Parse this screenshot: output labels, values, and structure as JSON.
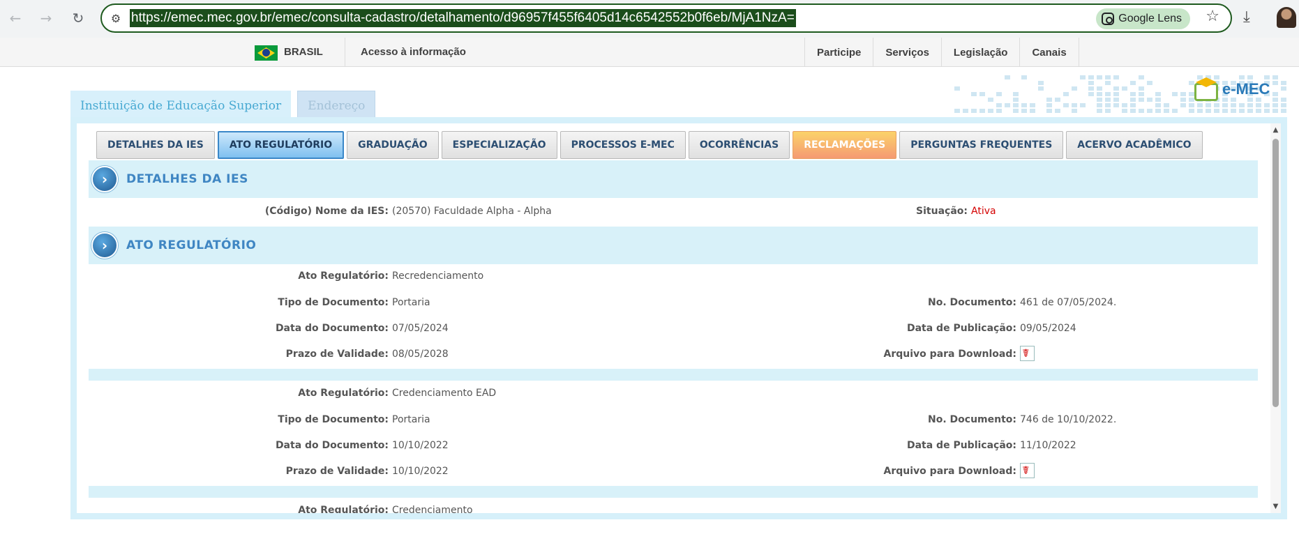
{
  "browser": {
    "url": "https://emec.mec.gov.br/emec/consulta-cadastro/detalhamento/d96957f455f6405d14c6542552b0f6eb/MjA1NzA=",
    "lens_label": "Google Lens",
    "icons": {
      "back": "back-arrow-icon",
      "forward": "forward-arrow-icon",
      "reload": "reload-icon",
      "tune": "site-settings-icon",
      "star": "bookmark-star-icon",
      "download": "download-icon"
    }
  },
  "govbar": {
    "country": "BRASIL",
    "access": "Acesso à informação",
    "links": [
      "Participe",
      "Serviços",
      "Legislação",
      "Canais"
    ]
  },
  "header": {
    "logo_text": "e-MEC",
    "outer_tabs": [
      "Instituição de Educação Superior",
      "Endereço"
    ]
  },
  "tabs": [
    "DETALHES DA IES",
    "ATO REGULATÓRIO",
    "GRADUAÇÃO",
    "ESPECIALIZAÇÃO",
    "PROCESSOS E-MEC",
    "OCORRÊNCIAS",
    "RECLAMAÇÕES",
    "PERGUNTAS FREQUENTES",
    "ACERVO ACADÊMICO"
  ],
  "active_tab": "ATO REGULATÓRIO",
  "details": {
    "title": "DETALHES DA IES",
    "name_label": "(Código) Nome da IES:",
    "name_value": "(20570) Faculdade Alpha - Alpha",
    "status_label": "Situação:",
    "status_value": "Ativa",
    "status_color": "#d40000"
  },
  "ato": {
    "title": "ATO REGULATÓRIO",
    "labels": {
      "ato": "Ato Regulatório:",
      "tipo": "Tipo de Documento:",
      "numero": "No. Documento:",
      "data_doc": "Data do Documento:",
      "data_pub": "Data de Publicação:",
      "prazo": "Prazo de Validade:",
      "arquivo": "Arquivo para Download:"
    },
    "records": [
      {
        "ato": "Recredenciamento",
        "tipo": "Portaria",
        "numero": "461 de 07/05/2024.",
        "data_doc": "07/05/2024",
        "data_pub": "09/05/2024",
        "prazo": "08/05/2028"
      },
      {
        "ato": "Credenciamento EAD",
        "tipo": "Portaria",
        "numero": "746 de 10/10/2022.",
        "data_doc": "10/10/2022",
        "data_pub": "11/10/2022",
        "prazo": "10/10/2022"
      },
      {
        "ato": "Credenciamento"
      }
    ]
  }
}
